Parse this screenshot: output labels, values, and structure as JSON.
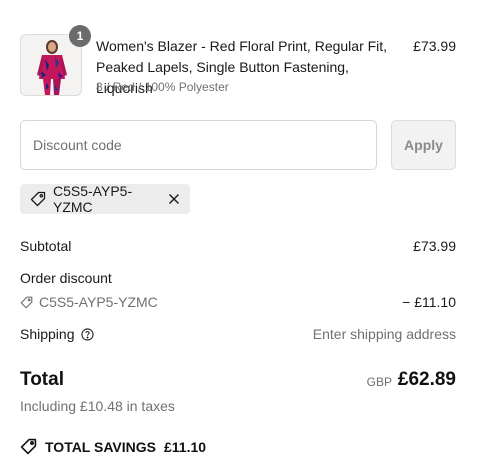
{
  "product": {
    "quantity": "1",
    "name": "Women's Blazer - Red Floral Print, Regular Fit, Peaked Lapels, Single Button Fastening, Liquorish",
    "variant": "8 / Red / 100% Polyester",
    "price": "£73.99"
  },
  "discount": {
    "placeholder": "Discount code",
    "apply_label": "Apply",
    "applied_code": "C5S5-AYP5-YZMC"
  },
  "summary": {
    "subtotal_label": "Subtotal",
    "subtotal_value": "£73.99",
    "order_discount_label": "Order discount",
    "discount_code": "C5S5-AYP5-YZMC",
    "discount_value": "− £11.10",
    "shipping_label": "Shipping",
    "shipping_value": "Enter shipping address",
    "total_label": "Total",
    "currency": "GBP",
    "total_value": "£62.89",
    "taxes_note": "Including £10.48 in taxes",
    "savings_label": "TOTAL SAVINGS",
    "savings_value": "£11.10"
  },
  "icons": {
    "tag": "tag-icon",
    "close": "close-icon",
    "help": "help-circle-icon",
    "savings": "tag-icon"
  },
  "colors": {
    "text": "#1a1a1a",
    "muted": "#707070",
    "badge": "#6b6b6b",
    "chip_bg": "#ececec",
    "button_bg": "#f2f2f2"
  }
}
